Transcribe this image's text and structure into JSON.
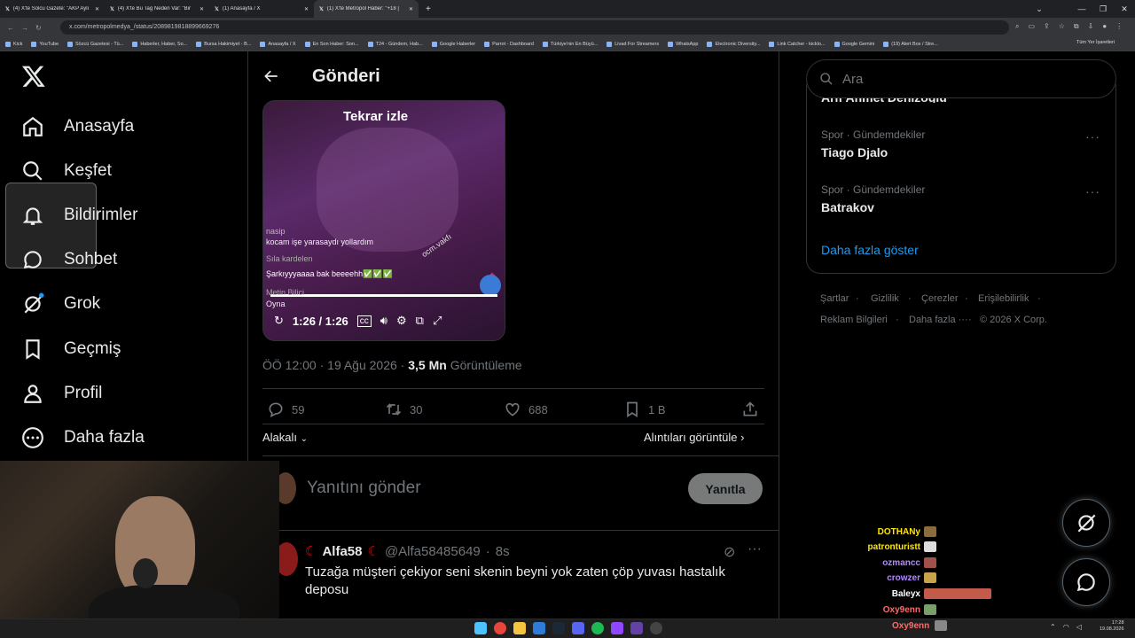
{
  "browser": {
    "tabs": [
      {
        "title": "(4) X'te Solcu Gazete: \"AKP Aylı"
      },
      {
        "title": "(4) X'te Bu Tag Neden Var: \"Bir"
      },
      {
        "title": "(1) Anasayfa / X"
      },
      {
        "title": "(1) X'te Metropol Haber: \"+18 |"
      }
    ],
    "url": "x.com/metropolmedya_/status/2089819818899669276",
    "bookmarks": [
      "Kick",
      "YouTube",
      "Sözcü Gazetesi - Tü...",
      "Haberler, Haber, So...",
      "Bursa Hakimiyet - B...",
      "Anasayfa / X",
      "En Son Haber: Son...",
      "T24 - Gündem, Hab...",
      "Google Haberler",
      "Parrot - Dashboard",
      "Türkiye'nin En Büyü...",
      "Livad For Streamers",
      "WhatsApp",
      "Electronic Diversity...",
      "Link Catcher - kicklo...",
      "Google Gemini",
      "(19) Alert Box / Stre..."
    ],
    "bookmarks_all": "Tüm Yer İşaretleri"
  },
  "nav": {
    "items": [
      {
        "label": "Anasayfa",
        "icon": "home-icon"
      },
      {
        "label": "Keşfet",
        "icon": "search-icon"
      },
      {
        "label": "Bildirimler",
        "icon": "bell-icon"
      },
      {
        "label": "Sohbet",
        "icon": "chat-icon"
      },
      {
        "label": "Grok",
        "icon": "grok-icon"
      },
      {
        "label": "Geçmiş",
        "icon": "bookmark-icon"
      },
      {
        "label": "Profil",
        "icon": "person-icon"
      },
      {
        "label": "Daha fazla",
        "icon": "more-circle-icon"
      }
    ]
  },
  "header": {
    "title": "Gönderi"
  },
  "video": {
    "replay": "Tekrar izle",
    "time": "1:26 / 1:26",
    "chat_lines": [
      {
        "user": "nasip",
        "text": "kocam işe yarasaydı yollardım"
      },
      {
        "user": "Sıla kardelen",
        "text": ""
      },
      {
        "user": "",
        "text": "Şarkıyyyaaaa bak beeeehh✅✅✅"
      },
      {
        "user": "Metin Bilici",
        "text": "Oyna"
      }
    ],
    "watermark": "ocm.vakfı"
  },
  "tweet": {
    "time": "ÖÖ 12:00",
    "date": "19 Ağu 2026",
    "views": "3,5 Mn",
    "views_label": "Görüntüleme",
    "replies": "59",
    "reposts": "30",
    "likes": "688",
    "bookmarks": "1 B",
    "related": "Alakalı",
    "quotes": "Alıntıları görüntüle"
  },
  "composer": {
    "placeholder": "Yanıtını gönder",
    "button": "Yanıtla"
  },
  "reply": {
    "name": "Alfa58",
    "handle": "@Alfa58485649",
    "time": "8s",
    "text": "Tuzağa müşteri çekiyor seni skenin beyni yok zaten çöp yuvası hastalık deposu"
  },
  "sidebar": {
    "search_placeholder": "Ara",
    "partial_trend": "Arif Ahmet Denizoğlu",
    "trends": [
      {
        "category": "Spor · Gündemdekiler",
        "name": "Tiago Djalo"
      },
      {
        "category": "Spor · Gündemdekiler",
        "name": "Batrakov"
      }
    ],
    "show_more": "Daha fazla göster",
    "footer": [
      "Şartlar",
      "Gizlilik",
      "Çerezler",
      "Erişilebilirlik",
      "Reklam Bilgileri",
      "Daha fazla ···",
      "© 2026 X Corp."
    ]
  },
  "stream_chat": [
    {
      "name": "DOTHANy",
      "color": "#ffe600"
    },
    {
      "name": "patronturistt",
      "color": "#ffe600"
    },
    {
      "name": "ozmancc",
      "color": "#b388ff"
    },
    {
      "name": "crowzer",
      "color": "#b388ff"
    },
    {
      "name": "Baleyx",
      "color": "#ffffff"
    },
    {
      "name": "Oxy9enn",
      "color": "#ff6b6b"
    }
  ],
  "taskbar": {
    "time": "17:28",
    "date": "19.08.2026"
  }
}
